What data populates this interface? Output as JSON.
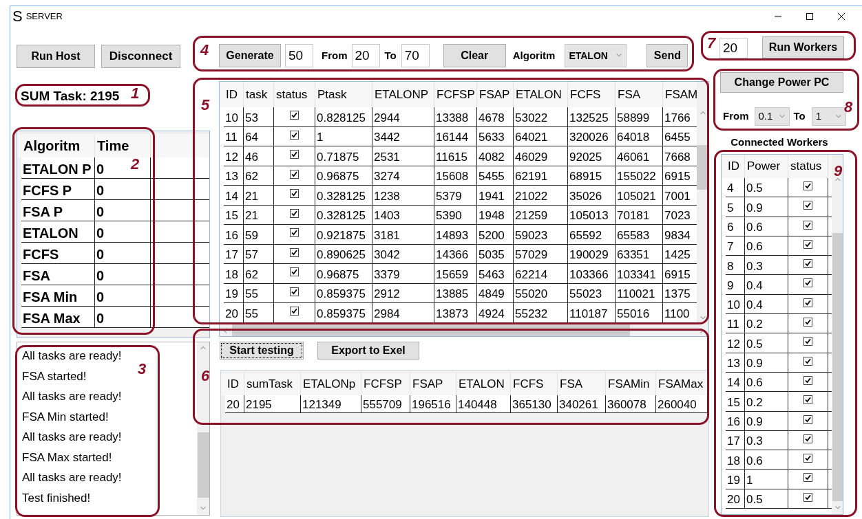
{
  "window": {
    "logo": "S",
    "title": "SERVER"
  },
  "host_buttons": [
    "Run Host",
    "Disconnect"
  ],
  "sum_task": "SUM Task: 2195",
  "algorithm_times": {
    "columns": [
      "Algoritm",
      "Time"
    ],
    "rows": [
      [
        "ETALON P",
        "0"
      ],
      [
        "FCFS P",
        "0"
      ],
      [
        "FSA P",
        "0"
      ],
      [
        "ETALON",
        "0"
      ],
      [
        "FCFS",
        "0"
      ],
      [
        "FSA",
        "0"
      ],
      [
        "FSA Min",
        "0"
      ],
      [
        "FSA Max",
        "0"
      ]
    ]
  },
  "log": [
    "All tasks are ready!",
    "FSA started!",
    "All tasks are ready!",
    "FSA Min started!",
    "All tasks are ready!",
    "FSA Max started!",
    "All tasks are ready!",
    "Test finished!"
  ],
  "generator": {
    "generate": "Generate",
    "count": "50",
    "from_label": "From",
    "from": "20",
    "to_label": "To",
    "to": "70",
    "clear": "Clear",
    "algorithm_label": "Algoritm",
    "algorithm": "ETALON",
    "send": "Send"
  },
  "tasks_table": {
    "columns": [
      "ID",
      "task",
      "status",
      "Ptask",
      "ETALONP",
      "FCFSP",
      "FSAP",
      "ETALON",
      "FCFS",
      "FSA",
      "FSAM"
    ],
    "rows": [
      {
        "id": "10",
        "task": "53",
        "status": true,
        "values": [
          "0.828125",
          "2944",
          "13388",
          "4678",
          "53022",
          "132525",
          "58899",
          "1766"
        ]
      },
      {
        "id": "11",
        "task": "64",
        "status": true,
        "values": [
          "1",
          "3442",
          "16144",
          "5633",
          "64021",
          "320026",
          "64018",
          "6455"
        ]
      },
      {
        "id": "12",
        "task": "46",
        "status": true,
        "values": [
          "0.71875",
          "2531",
          "11615",
          "4082",
          "46029",
          "92025",
          "46061",
          "7668"
        ]
      },
      {
        "id": "13",
        "task": "62",
        "status": true,
        "values": [
          "0.96875",
          "3274",
          "15608",
          "5455",
          "62191",
          "68915",
          "155022",
          "6915"
        ]
      },
      {
        "id": "14",
        "task": "21",
        "status": true,
        "values": [
          "0.328125",
          "1238",
          "5379",
          "1941",
          "21022",
          "35026",
          "105021",
          "7001"
        ]
      },
      {
        "id": "15",
        "task": "21",
        "status": true,
        "values": [
          "0.328125",
          "1403",
          "5390",
          "1948",
          "21259",
          "105013",
          "70181",
          "7023"
        ]
      },
      {
        "id": "16",
        "task": "59",
        "status": true,
        "values": [
          "0.921875",
          "3181",
          "14893",
          "5200",
          "59023",
          "65592",
          "65583",
          "9834"
        ]
      },
      {
        "id": "17",
        "task": "57",
        "status": true,
        "values": [
          "0.890625",
          "3042",
          "14366",
          "5035",
          "57029",
          "190029",
          "63351",
          "1425"
        ]
      },
      {
        "id": "18",
        "task": "62",
        "status": true,
        "values": [
          "0.96875",
          "3379",
          "15659",
          "5463",
          "62214",
          "103366",
          "103341",
          "6915"
        ]
      },
      {
        "id": "19",
        "task": "55",
        "status": true,
        "values": [
          "0.859375",
          "2912",
          "13885",
          "4849",
          "55020",
          "55023",
          "110021",
          "1375"
        ]
      },
      {
        "id": "20",
        "task": "55",
        "status": true,
        "values": [
          "0.859375",
          "2984",
          "13873",
          "4924",
          "55232",
          "110187",
          "55016",
          "1100"
        ]
      }
    ]
  },
  "testing": {
    "buttons": [
      {
        "label": "Start testing",
        "focused": true
      },
      {
        "label": "Export to Exel",
        "focused": false
      }
    ],
    "results": {
      "columns": [
        "ID",
        "sumTask",
        "ETALONp",
        "FCFSP",
        "FSAP",
        "ETALON",
        "FCFS",
        "FSA",
        "FSAMin",
        "FSAMax"
      ],
      "rows": [
        [
          "20",
          "2195",
          "121349",
          "555709",
          "196516",
          "140448",
          "365130",
          "340261",
          "360078",
          "260040"
        ]
      ]
    }
  },
  "workers_control": {
    "count": "20",
    "run": "Run Workers",
    "change_power": "Change Power PC",
    "from_label": "From",
    "from": "0.1",
    "to_label": "To",
    "to": "1"
  },
  "connected_workers": {
    "title": "Connected Workers",
    "columns": [
      "ID",
      "Power",
      "status"
    ],
    "rows": [
      {
        "id": "4",
        "power": "0.5",
        "status": true
      },
      {
        "id": "5",
        "power": "0.9",
        "status": true
      },
      {
        "id": "6",
        "power": "0.6",
        "status": true
      },
      {
        "id": "7",
        "power": "0.6",
        "status": true
      },
      {
        "id": "8",
        "power": "0.3",
        "status": true
      },
      {
        "id": "9",
        "power": "0.4",
        "status": true
      },
      {
        "id": "10",
        "power": "0.4",
        "status": true
      },
      {
        "id": "11",
        "power": "0.2",
        "status": true
      },
      {
        "id": "12",
        "power": "0.5",
        "status": true
      },
      {
        "id": "13",
        "power": "0.9",
        "status": true
      },
      {
        "id": "14",
        "power": "0.6",
        "status": true
      },
      {
        "id": "15",
        "power": "0.2",
        "status": true
      },
      {
        "id": "16",
        "power": "0.9",
        "status": true
      },
      {
        "id": "17",
        "power": "0.3",
        "status": true
      },
      {
        "id": "18",
        "power": "0.6",
        "status": true
      },
      {
        "id": "19",
        "power": "1",
        "status": true
      },
      {
        "id": "20",
        "power": "0.5",
        "status": true
      }
    ]
  },
  "annotations": [
    "1",
    "2",
    "3",
    "4",
    "5",
    "6",
    "7",
    "8",
    "9"
  ]
}
